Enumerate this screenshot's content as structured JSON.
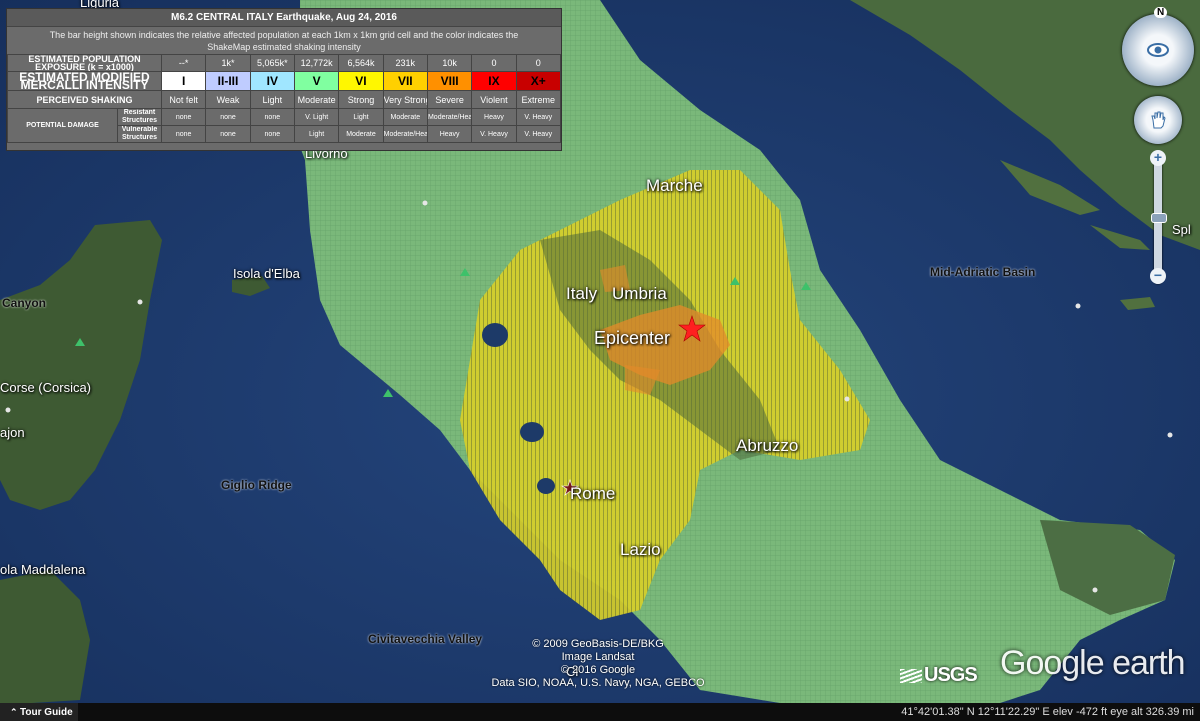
{
  "legend": {
    "title": "M6.2 CENTRAL ITALY Earthquake, Aug 24, 2016",
    "description": "The bar height shown indicates the relative affected population at each 1km x 1km grid cell and the color indicates the ShakeMap estimated shaking intensity",
    "rows": {
      "population_header": "ESTIMATED POPULATION EXPOSURE (k = x1000)",
      "mmi_header": "ESTIMATED MODIFIED MERCALLI INTENSITY",
      "shaking_header": "PERCEIVED SHAKING",
      "damage_header": "POTENTIAL DAMAGE",
      "resistant_header": "Resistant Structures",
      "vulnerable_header": "Vulnerable Structures"
    },
    "columns": [
      {
        "pop": "--*",
        "mmi": "I",
        "color": "#ffffff",
        "shaking": "Not felt",
        "resistant": "none",
        "vulnerable": "none"
      },
      {
        "pop": "1k*",
        "mmi": "II-III",
        "color": "#bfccff",
        "shaking": "Weak",
        "resistant": "none",
        "vulnerable": "none"
      },
      {
        "pop": "5,065k*",
        "mmi": "IV",
        "color": "#a0e6ff",
        "shaking": "Light",
        "resistant": "none",
        "vulnerable": "none"
      },
      {
        "pop": "12,772k",
        "mmi": "V",
        "color": "#80ffa0",
        "shaking": "Moderate",
        "resistant": "V. Light",
        "vulnerable": "Light"
      },
      {
        "pop": "6,564k",
        "mmi": "VI",
        "color": "#fff700",
        "shaking": "Strong",
        "resistant": "Light",
        "vulnerable": "Moderate"
      },
      {
        "pop": "231k",
        "mmi": "VII",
        "color": "#ffd000",
        "shaking": "Very Strong",
        "resistant": "Moderate",
        "vulnerable": "Moderate/Heavy"
      },
      {
        "pop": "10k",
        "mmi": "VIII",
        "color": "#ff9000",
        "shaking": "Severe",
        "resistant": "Moderate/Heavy",
        "vulnerable": "Heavy"
      },
      {
        "pop": "0",
        "mmi": "IX",
        "color": "#ff0000",
        "shaking": "Violent",
        "resistant": "Heavy",
        "vulnerable": "V. Heavy"
      },
      {
        "pop": "0",
        "mmi": "X+",
        "color": "#c80000",
        "shaking": "Extreme",
        "resistant": "V. Heavy",
        "vulnerable": "V. Heavy"
      }
    ]
  },
  "map_labels": {
    "marche": "Marche",
    "italy": "Italy",
    "umbria": "Umbria",
    "epicenter": "Epicenter",
    "abruzzo": "Abruzzo",
    "rome": "Rome",
    "lazio": "Lazio",
    "isola_delba": "Isola d'Elba",
    "mid_adriatic_basin": "Mid-Adriatic Basin",
    "giglio_ridge": "Giglio Ridge",
    "civitavecchia_valley": "Civitavecchia Valley",
    "corse": "Corse (Corsica)",
    "canyon": "Canyon",
    "la_maddalena": "ola Maddalena",
    "livorno": "Livorno",
    "liguria": "Liguria",
    "split": "Spl",
    "ajon": "ajon",
    "roma_partial": "Ci"
  },
  "attribution": {
    "line1": "© 2009 GeoBasis-DE/BKG",
    "line2": "Image Landsat",
    "line3": "© 2016 Google",
    "line4": "Data SIO, NOAA, U.S. Navy, NGA, GEBCO"
  },
  "logos": {
    "usgs": "USGS",
    "google_earth": "Google earth"
  },
  "nav": {
    "north": "N",
    "zoom_in": "+",
    "zoom_out": "−"
  },
  "statusbar": {
    "tour_guide": "Tour Guide",
    "coordinates": "41°42'01.38\" N   12°11'22.29\" E   elev  -472 ft        eye alt 326.39 mi"
  },
  "colors": {
    "sea": "#1c3b6e",
    "land_green": "#7ab87a",
    "yellow_shaking": "#d6cf2a",
    "orange_shaking": "#e48a2a",
    "epicenter_star": "#ff2020"
  }
}
